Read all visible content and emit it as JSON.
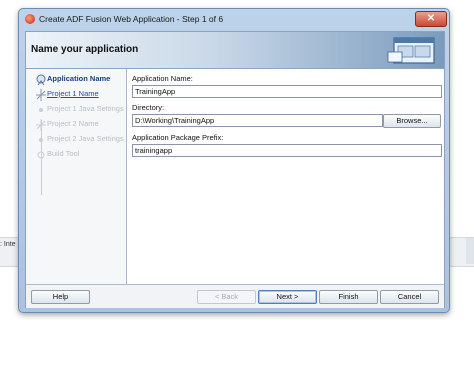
{
  "background": {
    "strip_text": ": Inte"
  },
  "window": {
    "title": "Create ADF Fusion Web Application - Step 1 of 6",
    "close_glyph": "✕"
  },
  "header": {
    "title": "Name your application",
    "icon": "wizard-window-icon"
  },
  "steps": [
    {
      "label": "Application Name",
      "state": "current"
    },
    {
      "label": "Project 1 Name",
      "state": "link"
    },
    {
      "label": "Project 1 Java Settings",
      "state": "disabled"
    },
    {
      "label": "Project 2 Name",
      "state": "disabled"
    },
    {
      "label": "Project 2 Java Settings",
      "state": "disabled"
    },
    {
      "label": "Build Tool",
      "state": "disabled"
    }
  ],
  "form": {
    "app_name_label": "Application Name:",
    "app_name_value": "TrainingApp",
    "directory_label": "Directory:",
    "directory_value": "D:\\Working\\TrainingApp",
    "browse_label": "Browse...",
    "package_label": "Application Package Prefix:",
    "package_value": "trainingapp"
  },
  "buttons": {
    "help": "Help",
    "back": "< Back",
    "next": "Next >",
    "finish": "Finish",
    "cancel": "Cancel"
  },
  "colors": {
    "accent": "#1a3f80",
    "link": "#1f4fa8",
    "disabled": "#b9bec6"
  }
}
